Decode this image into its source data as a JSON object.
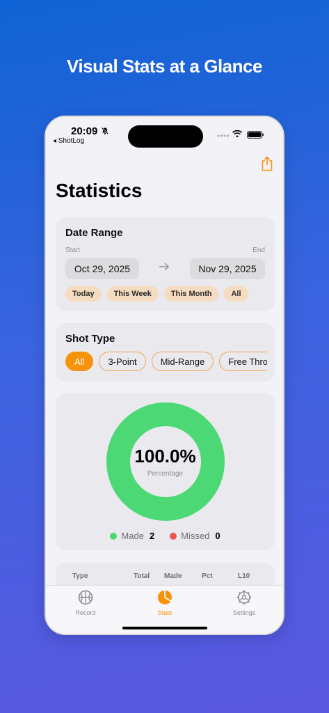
{
  "headline": "Visual Stats at a Glance",
  "status_bar": {
    "time": "20:09",
    "back_label": "◂ ShotLog"
  },
  "page_title": "Statistics",
  "date_range": {
    "title": "Date Range",
    "start_label": "Start",
    "end_label": "End",
    "start_date": "Oct 29, 2025",
    "end_date": "Nov 29, 2025",
    "quick": [
      "Today",
      "This Week",
      "This Month",
      "All"
    ]
  },
  "shot_type": {
    "title": "Shot Type",
    "options": [
      "All",
      "3-Point",
      "Mid-Range",
      "Free Throw"
    ],
    "selected": "All"
  },
  "chart_data": {
    "type": "pie",
    "variant": "donut",
    "categories": [
      "Made",
      "Missed"
    ],
    "values": [
      2,
      0
    ],
    "colors": [
      "#4cd874",
      "#ef5350"
    ],
    "center_value": "100.0%",
    "center_label": "Percentage"
  },
  "legend": {
    "made_label": "Made",
    "made_value": "2",
    "missed_label": "Missed",
    "missed_value": "0"
  },
  "table": {
    "headers": [
      "Type",
      "Total",
      "Made",
      "Pct",
      "L10"
    ]
  },
  "tabs": [
    {
      "label": "Record",
      "icon": "basketball-icon",
      "active": false
    },
    {
      "label": "Stats",
      "icon": "pie-chart-icon",
      "active": true
    },
    {
      "label": "Settings",
      "icon": "gear-icon",
      "active": false
    }
  ],
  "colors": {
    "accent": "#f7930b",
    "made": "#4cd874",
    "missed": "#ef5350",
    "chip_bg": "#f5dcc0",
    "inactive_tab": "#8e8e93"
  }
}
